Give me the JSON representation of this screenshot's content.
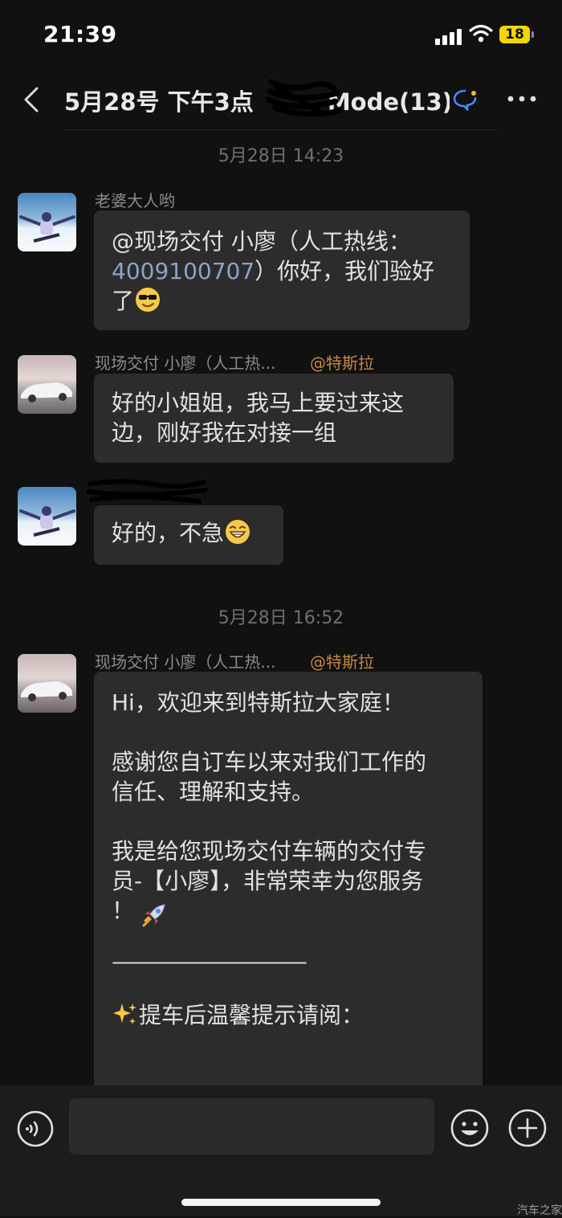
{
  "status_bar": {
    "time": "21:39",
    "battery": "18"
  },
  "header": {
    "title_left": "5月28号 下午3点",
    "title_right": "Mode",
    "member_count": "(13)"
  },
  "chat": {
    "timestamps": [
      "5月28日 14:23",
      "5月28日 16:52"
    ],
    "messages": [
      {
        "sender": "老婆大人哟",
        "prefix": "@现场交付 小廖（人工热线：",
        "phone": "4009100707",
        "suffix": "）你好，我们验好了"
      },
      {
        "sender": "现场交付 小廖（人工热...",
        "mention": "@特斯拉",
        "text": "好的小姐姐，我马上要过来这边，刚好我在对接一组"
      },
      {
        "text": "好的，不急"
      },
      {
        "sender": "现场交付 小廖（人工热...",
        "mention": "@特斯拉",
        "text": "Hi，欢迎来到特斯拉大家庭！\n\n感谢您自订车以来对我们工作的\n信任、理解和支持。\n\n我是给您现场交付车辆的交付专\n员-【小廖】，非常荣幸为您服务\n！",
        "divider": "——————————",
        "tip": "提车后温馨提示请阅："
      }
    ]
  },
  "composer": {
    "placeholder": ""
  },
  "watermark": "汽车之家",
  "colors": {
    "background": "#111111",
    "bubble": "#2c2c2c",
    "mention": "#c48a3e",
    "link": "#8ba3c8"
  }
}
